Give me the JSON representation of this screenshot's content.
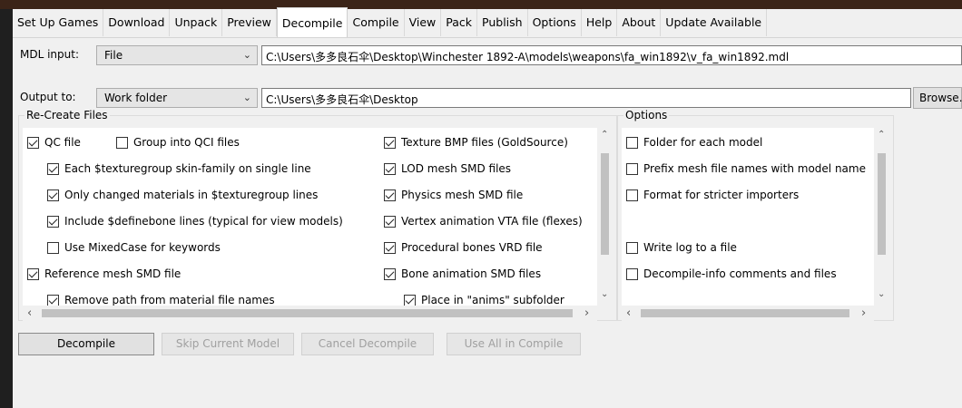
{
  "tabs": [
    "Set Up Games",
    "Download",
    "Unpack",
    "Preview",
    "Decompile",
    "Compile",
    "View",
    "Pack",
    "Publish",
    "Options",
    "Help",
    "About",
    "Update Available"
  ],
  "mdl": {
    "label": "MDL input:",
    "mode": "File",
    "path": "C:\\Users\\多多良石伞\\Desktop\\Winchester 1892-A\\models\\weapons\\fa_win1892\\v_fa_win1892.mdl"
  },
  "output": {
    "label": "Output to:",
    "mode": "Work folder",
    "path": "C:\\Users\\多多良石伞\\Desktop",
    "browse": "Browse..."
  },
  "recreate": {
    "title": "Re-Create Files",
    "left": [
      {
        "label": "QC file",
        "checked": true
      },
      {
        "label": "Group into QCI files",
        "checked": false
      },
      {
        "label": "Each $texturegroup skin-family on single line",
        "checked": true
      },
      {
        "label": "Only changed materials in $texturegroup lines",
        "checked": true
      },
      {
        "label": "Include $definebone lines (typical for view models)",
        "checked": true
      },
      {
        "label": "Use MixedCase for keywords",
        "checked": false
      },
      {
        "label": "Reference mesh SMD file",
        "checked": true
      },
      {
        "label": "Remove path from material file names",
        "checked": true
      }
    ],
    "right": [
      {
        "label": "Texture BMP files (GoldSource)",
        "checked": true
      },
      {
        "label": "LOD mesh SMD files",
        "checked": true
      },
      {
        "label": "Physics mesh SMD file",
        "checked": true
      },
      {
        "label": "Vertex animation VTA file (flexes)",
        "checked": true
      },
      {
        "label": "Procedural bones VRD file",
        "checked": true
      },
      {
        "label": "Bone animation SMD files",
        "checked": true
      },
      {
        "label": "Place in \"anims\" subfolder",
        "checked": true
      }
    ]
  },
  "options": {
    "title": "Options",
    "items": [
      {
        "label": "Folder for each model",
        "checked": false
      },
      {
        "label": "Prefix mesh file names with model name",
        "checked": false
      },
      {
        "label": "Format for stricter importers",
        "checked": false
      },
      {
        "label": "Write log to a file",
        "checked": false
      },
      {
        "label": "Decompile-info comments and files",
        "checked": false
      }
    ]
  },
  "buttons": {
    "decompile": "Decompile",
    "skip": "Skip Current Model",
    "cancel": "Cancel Decompile",
    "use_all": "Use All in Compile"
  }
}
